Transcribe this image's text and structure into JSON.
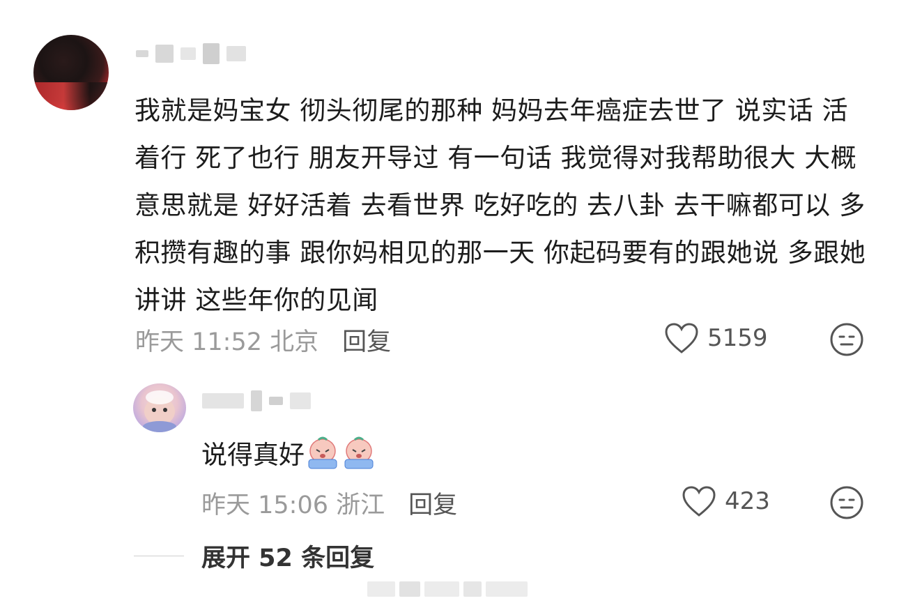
{
  "comment": {
    "username": "",
    "text": "我就是妈宝女 彻头彻尾的那种 妈妈去年癌症去世了 说实话 活着行 死了也行 朋友开导过 有一句话 我觉得对我帮助很大 大概意思就是 好好活着 去看世界 吃好吃的 去八卦 去干嘛都可以 多积攒有趣的事 跟你妈相见的那一天 你起码要有的跟她说 多跟她讲讲 这些年你的见闻",
    "time": "昨天 11:52",
    "location": "北京",
    "reply_label": "回复",
    "like_count": "5159"
  },
  "reply": {
    "username": "",
    "text": "说得真好",
    "time": "昨天 15:06",
    "location": "浙江",
    "reply_label": "回复",
    "like_count": "423"
  },
  "expand": {
    "label": "展开 52 条回复"
  },
  "icons": {
    "like": "heart-outline-icon",
    "dislike": "meh-face-icon",
    "emoji": "crying-emoji-icon"
  },
  "colors": {
    "text": "#1c1c1c",
    "meta": "#9a9a9a",
    "action": "#555555"
  }
}
